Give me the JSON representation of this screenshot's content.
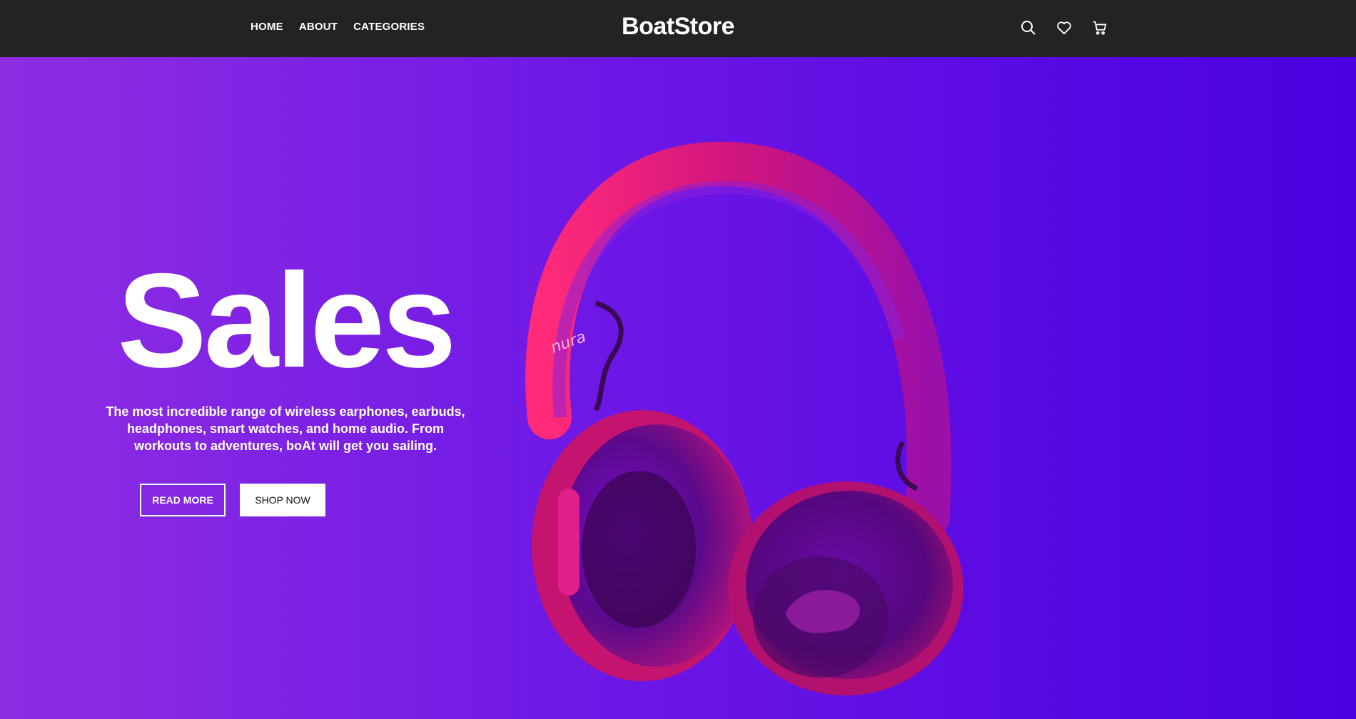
{
  "nav": {
    "items": [
      "HOME",
      "ABOUT",
      "CATEGORIES"
    ]
  },
  "brand": {
    "name": "BoatStore"
  },
  "icons": [
    "search-icon",
    "heart-icon",
    "cart-icon"
  ],
  "hero": {
    "title": "Sales",
    "description": "The most incredible range of wireless earphones, earbuds, headphones, smart watches, and home audio. From workouts to adventures, boAt will get you sailing.",
    "read_more_label": "READ MORE",
    "shop_now_label": "SHOP NOW",
    "product_brand": "nura"
  },
  "colors": {
    "topbar": "#232323",
    "hero_gradient_start": "#8e2de2",
    "hero_gradient_end": "#4a00e0",
    "headphone_accent": "#ff1f7a"
  }
}
